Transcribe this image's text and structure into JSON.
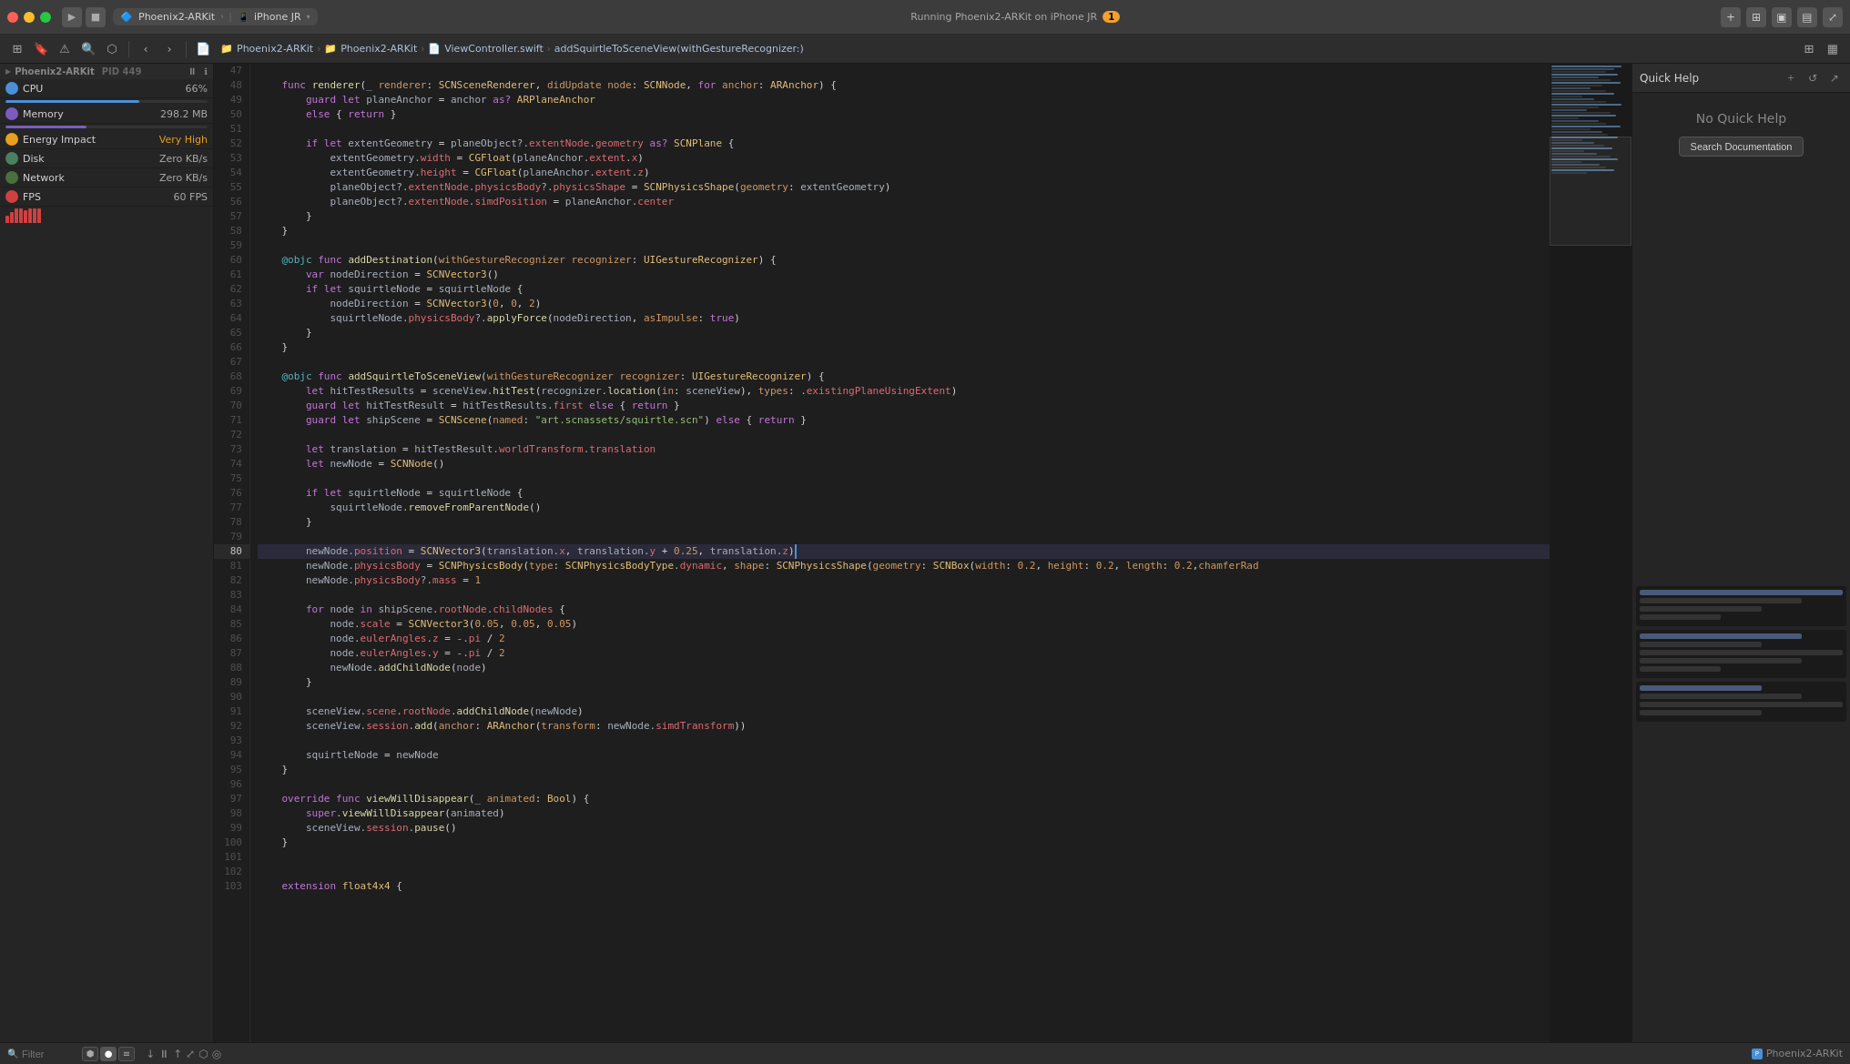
{
  "titlebar": {
    "traffic_lights": [
      "red",
      "yellow",
      "green"
    ],
    "scheme_name": "Phoenix2-ARKit",
    "device_name": "iPhone JR",
    "status_text": "Running Phoenix2-ARKit on iPhone JR",
    "warning_count": "1",
    "run_label": "▶",
    "stop_label": "■"
  },
  "breadcrumb": {
    "items": [
      {
        "label": "Phoenix2-ARKit",
        "icon": "📁"
      },
      {
        "label": "Phoenix2-ARKit",
        "icon": "📁"
      },
      {
        "label": "ViewController.swift",
        "icon": "📄"
      },
      {
        "label": "addSquirtleToSceneView(withGestureRecognizer:)",
        "icon": ""
      }
    ]
  },
  "navigator": {
    "project_label": "Phoenix2-ARKit PID 449",
    "debug_items": [
      {
        "label": "CPU",
        "value": "66%",
        "bar_pct": 66
      },
      {
        "label": "Memory",
        "value": "298.2 MB",
        "bar_pct": 40
      },
      {
        "label": "Energy Impact",
        "value": "Very High"
      },
      {
        "label": "Disk",
        "value": "Zero KB/s"
      },
      {
        "label": "Network",
        "value": "Zero KB/s"
      },
      {
        "label": "FPS",
        "value": "60 FPS"
      }
    ]
  },
  "quick_help": {
    "title": "Quick Help",
    "no_help_text": "No Quick Help",
    "search_docs_label": "Search Documentation"
  },
  "statusbar": {
    "filter_placeholder": "Filter",
    "scheme_label": "Phoenix2-ARKit"
  },
  "code": {
    "lines": [
      {
        "num": 47,
        "text": ""
      },
      {
        "num": 48,
        "text": "    func renderer(_ renderer: SCNSceneRenderer, didUpdate node: SCNNode, for anchor: ARAnchor) {"
      },
      {
        "num": 49,
        "text": "        guard let planeAnchor = anchor as? ARPlaneAnchor"
      },
      {
        "num": 50,
        "text": "        else { return }"
      },
      {
        "num": 51,
        "text": ""
      },
      {
        "num": 52,
        "text": "        if let extentGeometry = planeObject?.extentNode.geometry as? SCNPlane {"
      },
      {
        "num": 53,
        "text": "            extentGeometry.width = CGFloat(planeAnchor.extent.x)"
      },
      {
        "num": 54,
        "text": "            extentGeometry.height = CGFloat(planeAnchor.extent.z)"
      },
      {
        "num": 55,
        "text": "            planeObject?.extentNode.physicsBody?.physicsShape = SCNPhysicsShape(geometry: extentGeometry)"
      },
      {
        "num": 56,
        "text": "            planeObject?.extentNode.simdPosition = planeAnchor.center"
      },
      {
        "num": 57,
        "text": "        }"
      },
      {
        "num": 58,
        "text": "    }"
      },
      {
        "num": 59,
        "text": ""
      },
      {
        "num": 60,
        "text": "    @objc func addDestination(withGestureRecognizer recognizer: UIGestureRecognizer) {"
      },
      {
        "num": 61,
        "text": "        var nodeDirection = SCNVector3()"
      },
      {
        "num": 62,
        "text": "        if let squirtleNode = squirtleNode {"
      },
      {
        "num": 63,
        "text": "            nodeDirection = SCNVector3(0, 0, 2)"
      },
      {
        "num": 64,
        "text": "            squirtleNode.physicsBody?.applyForce(nodeDirection, asImpulse: true)"
      },
      {
        "num": 65,
        "text": "        }"
      },
      {
        "num": 66,
        "text": "    }"
      },
      {
        "num": 67,
        "text": ""
      },
      {
        "num": 68,
        "text": "    @objc func addSquirtleToSceneView(withGestureRecognizer recognizer: UIGestureRecognizer) {"
      },
      {
        "num": 69,
        "text": "        let hitTestResults = sceneView.hitTest(recognizer.location(in: sceneView), types: .existingPlaneUsingExtent)"
      },
      {
        "num": 70,
        "text": "        guard let hitTestResult = hitTestResults.first else { return }"
      },
      {
        "num": 71,
        "text": "        guard let shipScene = SCNScene(named: \"art.scnassets/squirtle.scn\") else { return }"
      },
      {
        "num": 72,
        "text": ""
      },
      {
        "num": 73,
        "text": "        let translation = hitTestResult.worldTransform.translation"
      },
      {
        "num": 74,
        "text": "        let newNode = SCNNode()"
      },
      {
        "num": 75,
        "text": ""
      },
      {
        "num": 76,
        "text": "        if let squirtleNode = squirtleNode {"
      },
      {
        "num": 77,
        "text": "            squirtleNode.removeFromParentNode()"
      },
      {
        "num": 78,
        "text": "        }"
      },
      {
        "num": 79,
        "text": ""
      },
      {
        "num": 80,
        "text": "        newNode.position = SCNVector3(translation.x, translation.y + 0.25, translation.z)",
        "current": true
      },
      {
        "num": 81,
        "text": "        newNode.physicsBody = SCNPhysicsBody(type: SCNPhysicsBodyType.dynamic, shape: SCNPhysicsShape(geometry: SCNBox(width: 0.2, height: 0.2, length: 0.2,chamferRad"
      },
      {
        "num": 82,
        "text": "        newNode.physicsBody?.mass = 1"
      },
      {
        "num": 83,
        "text": ""
      },
      {
        "num": 84,
        "text": "        for node in shipScene.rootNode.childNodes {"
      },
      {
        "num": 85,
        "text": "            node.scale = SCNVector3(0.05, 0.05, 0.05)"
      },
      {
        "num": 86,
        "text": "            node.eulerAngles.z = -.pi / 2"
      },
      {
        "num": 87,
        "text": "            node.eulerAngles.y = -.pi / 2"
      },
      {
        "num": 88,
        "text": "            newNode.addChildNode(node)"
      },
      {
        "num": 89,
        "text": "        }"
      },
      {
        "num": 90,
        "text": ""
      },
      {
        "num": 91,
        "text": "        sceneView.scene.rootNode.addChildNode(newNode)"
      },
      {
        "num": 92,
        "text": "        sceneView.session.add(anchor: ARAnchor(transform: newNode.simdTransform))"
      },
      {
        "num": 93,
        "text": ""
      },
      {
        "num": 94,
        "text": "        squirtleNode = newNode"
      },
      {
        "num": 95,
        "text": "    }"
      },
      {
        "num": 96,
        "text": ""
      },
      {
        "num": 97,
        "text": "    override func viewWillDisappear(_ animated: Bool) {"
      },
      {
        "num": 98,
        "text": "        super.viewWillDisappear(animated)"
      },
      {
        "num": 99,
        "text": "        sceneView.session.pause()"
      },
      {
        "num": 100,
        "text": "    }"
      },
      {
        "num": 101,
        "text": ""
      },
      {
        "num": 102,
        "text": ""
      },
      {
        "num": 103,
        "text": "    extension float4x4 {"
      }
    ]
  }
}
